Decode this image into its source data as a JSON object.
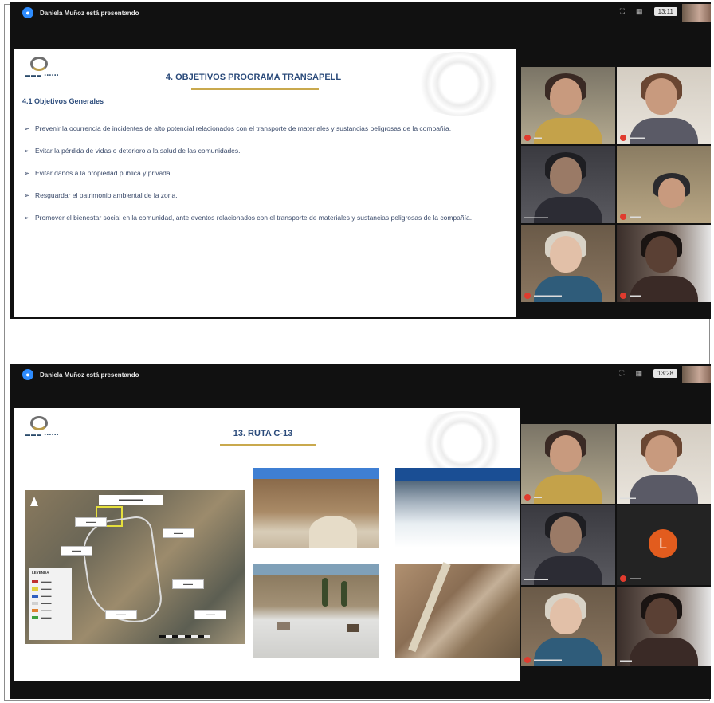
{
  "meeting1": {
    "presenter_banner": "Daniela Muñoz está presentando",
    "clock": "13:11",
    "slide": {
      "title": "4. OBJETIVOS PROGRAMA TRANSAPELL",
      "section": "4.1 Objetivos Generales",
      "bullets": [
        "Prevenir la ocurrencia de incidentes de alto potencial relacionados con el transporte de materiales y sustancias peligrosas de la compañía.",
        "Evitar la pérdida de vidas o deterioro a la salud de las comunidades.",
        "Evitar daños a la propiedad pública y privada.",
        "Resguardar el patrimonio ambiental de la zona.",
        "Promover el bienestar social en la comunidad, ante eventos relacionados con el transporte de materiales y sustancias peligrosas de la compañía."
      ]
    }
  },
  "meeting2": {
    "presenter_banner": "Daniela Muñoz está presentando",
    "clock": "13:28",
    "avatar_letter": "L",
    "slide": {
      "title": "13. RUTA C-13"
    },
    "map": {
      "legend_title": "LEYENDA"
    }
  },
  "colors": {
    "title_blue": "#2a4a7a",
    "accent_gold": "#c9a94e",
    "mic_red": "#e03b2e",
    "zoom_blue": "#2d8cff",
    "avatar_orange": "#e25c1e"
  },
  "icons": [
    "presenter-icon",
    "mic-muted-icon",
    "north-arrow-icon"
  ]
}
